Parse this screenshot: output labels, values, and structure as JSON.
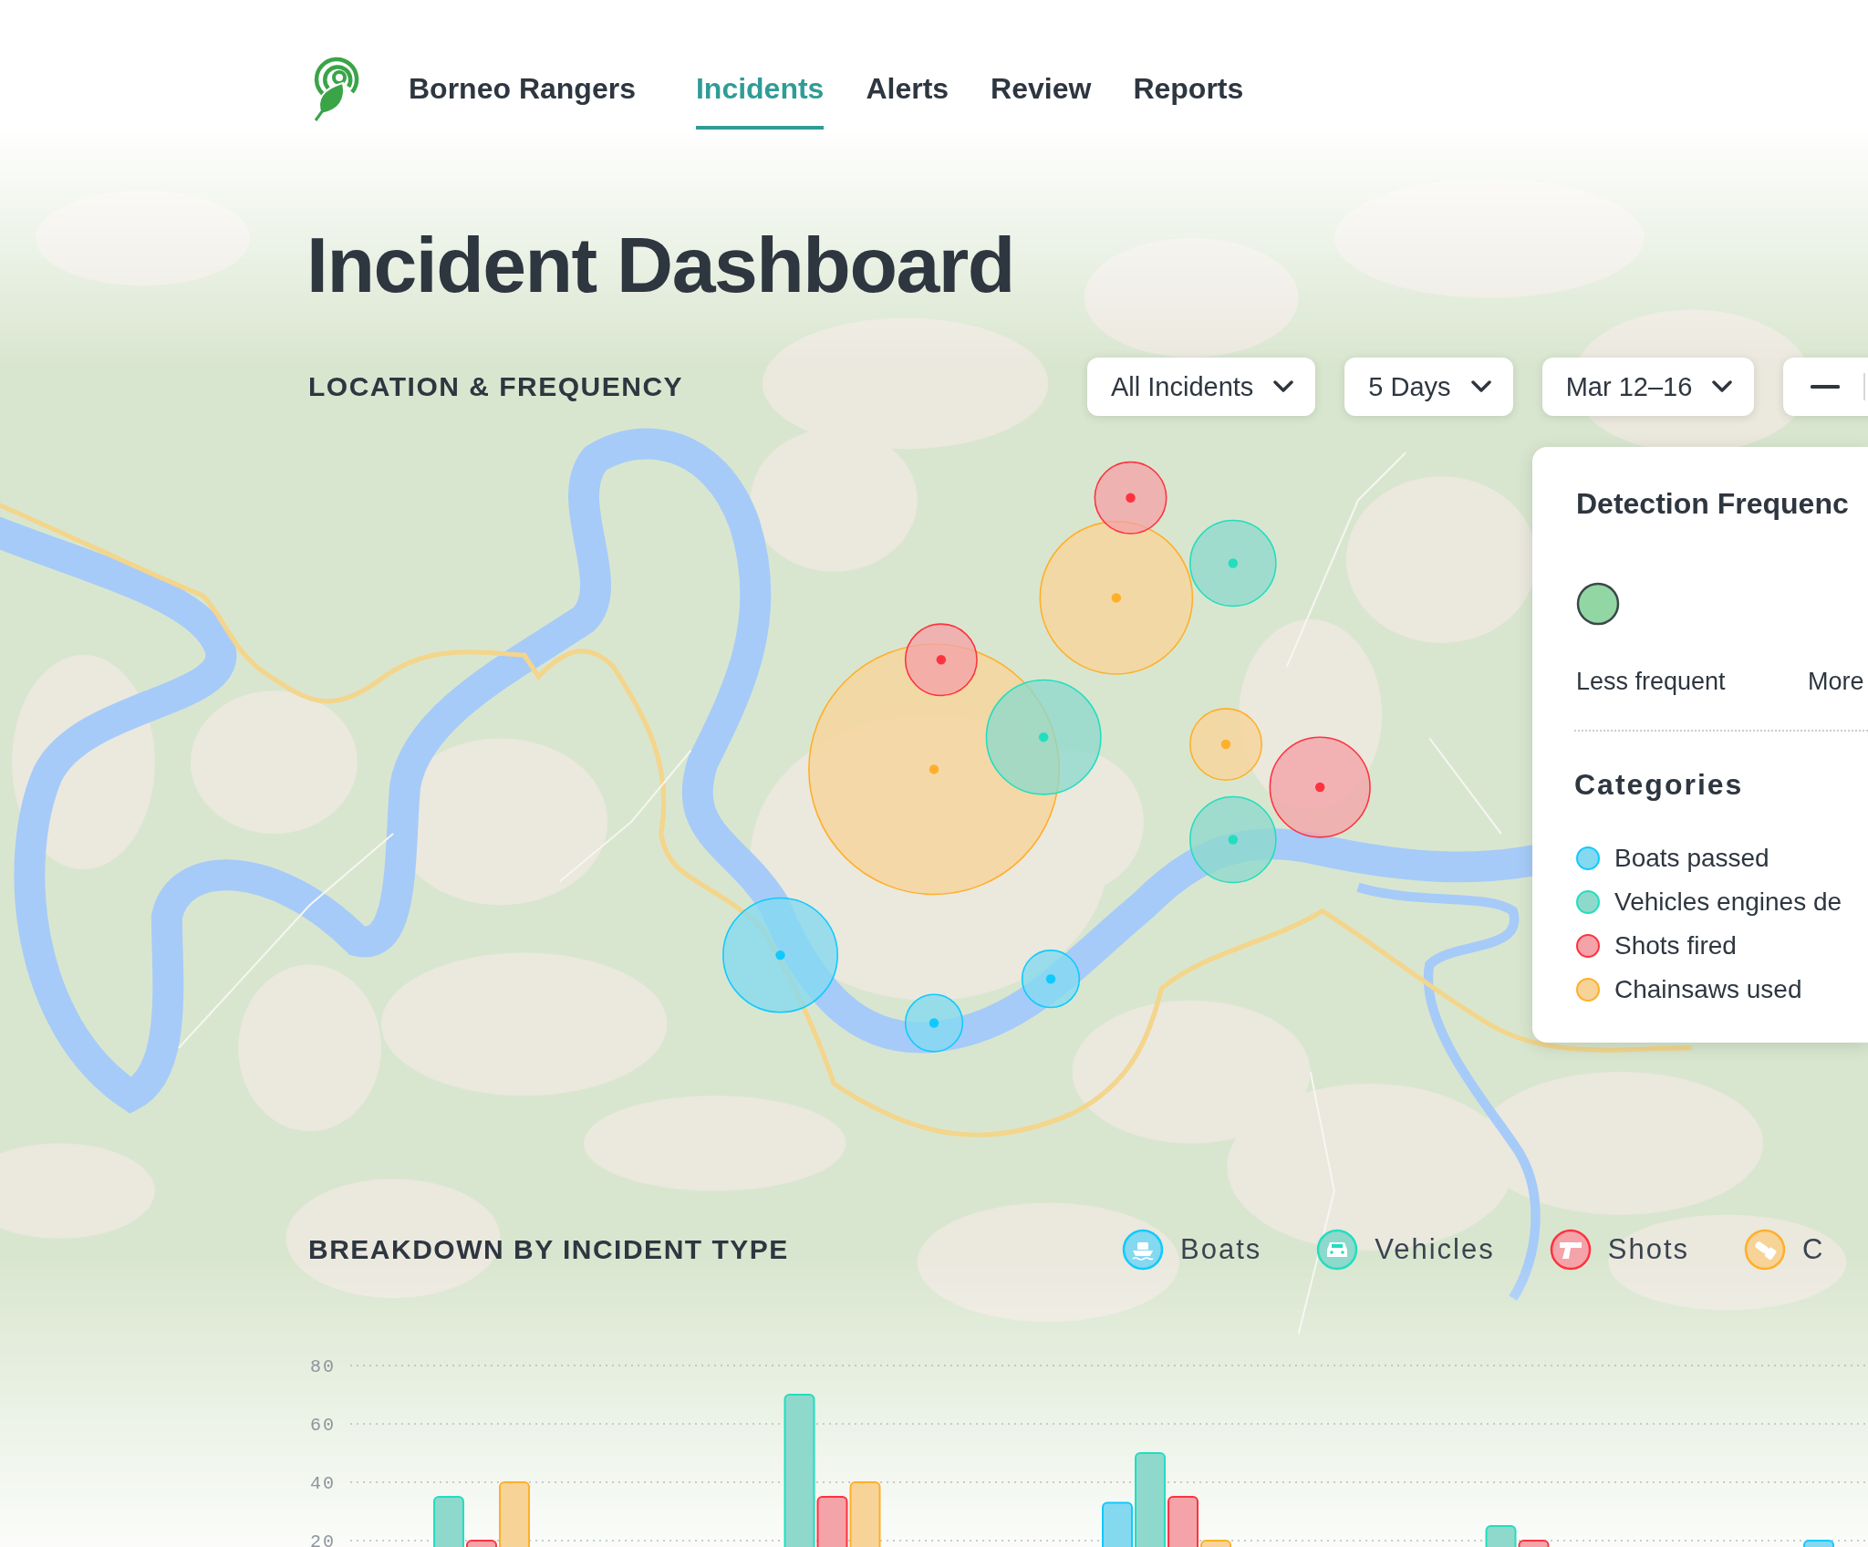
{
  "header": {
    "brand": "Borneo Rangers",
    "tabs": [
      {
        "label": "Incidents",
        "selected": true
      },
      {
        "label": "Alerts",
        "selected": false
      },
      {
        "label": "Review",
        "selected": false
      },
      {
        "label": "Reports",
        "selected": false
      }
    ]
  },
  "title": "Incident Dashboard",
  "location_section": {
    "heading": "LOCATION & FREQUENCY",
    "filters": [
      {
        "label": "All Incidents"
      },
      {
        "label": "5 Days"
      },
      {
        "label": "Mar 12–16"
      }
    ],
    "legend": {
      "title": "Detection Frequenc",
      "scale_labels": [
        "Less frequent",
        "More"
      ],
      "categories_heading": "Categories",
      "categories": [
        {
          "label": "Boats passed",
          "color": "#84d8f0"
        },
        {
          "label": "Vehicles engines de",
          "color": "#8ed8cc"
        },
        {
          "label": "Shots fired",
          "color": "#f4a3a8"
        },
        {
          "label": "Chainsaws used",
          "color": "#f7d397"
        }
      ]
    }
  },
  "breakdown": {
    "heading": "BREAKDOWN BY INCIDENT TYPE",
    "chart_data": {
      "type": "bar",
      "ylim": [
        0,
        80
      ],
      "grid": true,
      "yticks": [
        20,
        40,
        60,
        80
      ],
      "series": [
        {
          "name": "Boats",
          "color": "#84d8f0",
          "values": [
            null,
            null,
            33,
            null,
            20
          ]
        },
        {
          "name": "Vehicles",
          "color": "#8ed8cc",
          "values": [
            35,
            70,
            50,
            25,
            null
          ]
        },
        {
          "name": "Shots",
          "color": "#f4a3a8",
          "values": [
            20,
            35,
            35,
            20,
            null
          ]
        },
        {
          "name": "C",
          "color": "#f7d397",
          "values": [
            40,
            40,
            20,
            null,
            null
          ]
        }
      ]
    }
  }
}
